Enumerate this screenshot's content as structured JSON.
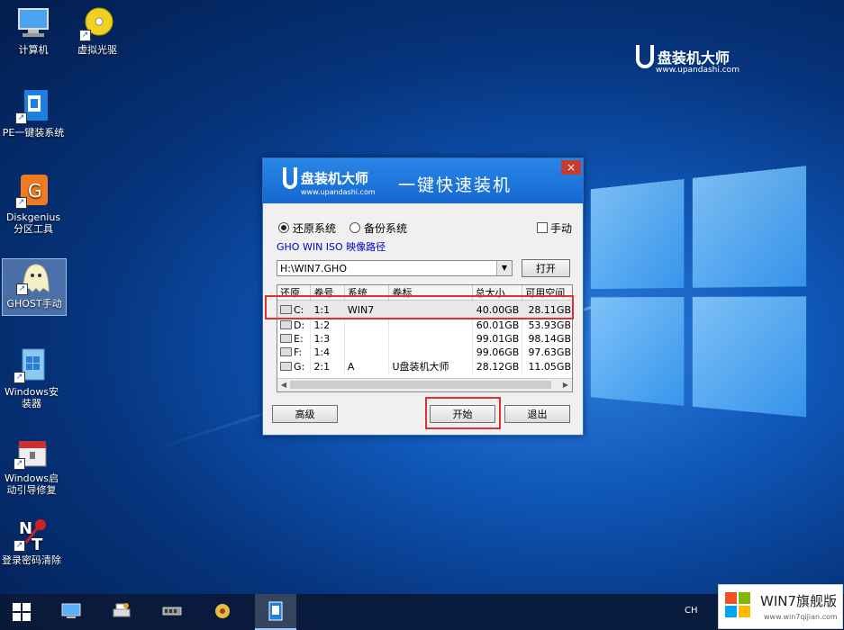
{
  "brand": {
    "name": "盘装机大师",
    "url": "www.upandashi.com"
  },
  "desktop_icons": [
    {
      "label": "计算机"
    },
    {
      "label": "虚拟光驱"
    },
    {
      "label": "PE一键装系统"
    },
    {
      "label": "Diskgenius分区工具"
    },
    {
      "label": "GHOST手动"
    },
    {
      "label": "Windows安装器"
    },
    {
      "label": "Windows启动引导修复"
    },
    {
      "label": "登录密码清除"
    }
  ],
  "dialog": {
    "logo_name": "盘装机大师",
    "logo_url": "www.upandashi.com",
    "slogan": "一键快速装机",
    "close": "×",
    "radio_restore": "还原系统",
    "radio_backup": "备份系统",
    "manual_checkbox": "手动",
    "path_label": "GHO WIN ISO 映像路径",
    "path_value": "H:\\WIN7.GHO",
    "open_button": "打开",
    "columns": [
      "还原",
      "卷号",
      "系统",
      "卷标",
      "总大小",
      "可用空间"
    ],
    "rows": [
      {
        "drive": "C:",
        "vol": "1:1",
        "sys": "WIN7",
        "label": "",
        "total": "40.00GB",
        "free": "28.11GB"
      },
      {
        "drive": "D:",
        "vol": "1:2",
        "sys": "",
        "label": "",
        "total": "60.01GB",
        "free": "53.93GB"
      },
      {
        "drive": "E:",
        "vol": "1:3",
        "sys": "",
        "label": "",
        "total": "99.01GB",
        "free": "98.14GB"
      },
      {
        "drive": "F:",
        "vol": "1:4",
        "sys": "",
        "label": "",
        "total": "99.06GB",
        "free": "97.63GB"
      },
      {
        "drive": "G:",
        "vol": "2:1",
        "sys": "A",
        "label": "U盘装机大师",
        "total": "28.12GB",
        "free": "11.05GB"
      }
    ],
    "advanced_button": "高级",
    "start_button": "开始",
    "exit_button": "退出"
  },
  "taskbar": {
    "tray_lang": "CH"
  },
  "watermark": {
    "title": "WIN7旗舰版",
    "url": "www.win7qijian.com"
  }
}
